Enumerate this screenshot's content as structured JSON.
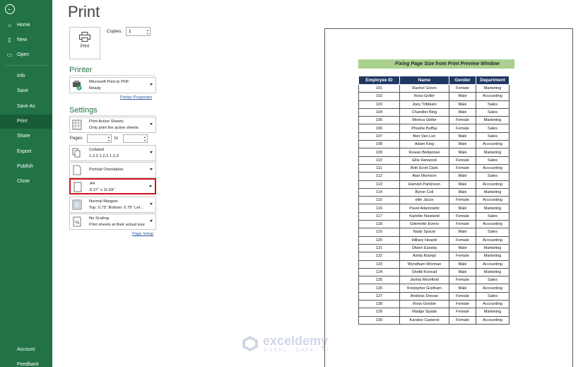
{
  "sidebar": {
    "back_icon": "arrow-left-icon",
    "items_top": [
      {
        "label": "Home",
        "icon": "home-icon"
      },
      {
        "label": "New",
        "icon": "new-file-icon"
      },
      {
        "label": "Open",
        "icon": "folder-open-icon"
      }
    ],
    "items_mid": [
      "Info",
      "Save",
      "Save As",
      "Print",
      "Share",
      "Export",
      "Publish",
      "Close"
    ],
    "active": "Print",
    "items_bottom": [
      "Account",
      "Feedback"
    ]
  },
  "print_panel": {
    "title": "Print",
    "print_button_label": "Print",
    "copies_label": "Copies:",
    "copies_value": "1",
    "printer_header": "Printer",
    "printer_name": "Microsoft Print to PDF",
    "printer_status": "Ready",
    "printer_properties_link": "Printer Properties",
    "settings_header": "Settings",
    "options": [
      {
        "line1": "Print Active Sheets",
        "line2": "Only print the active sheets",
        "icon": "sheets-icon"
      },
      {
        "line1": "Collated",
        "line2": "1,2,3    1,2,3    1,2,3",
        "icon": "collate-icon"
      },
      {
        "line1": "Portrait Orientation",
        "line2": "",
        "icon": "portrait-page-icon"
      },
      {
        "line1": "A4",
        "line2": "8.27\" x 11.69\"",
        "icon": "paper-size-icon"
      },
      {
        "line1": "Normal Margins",
        "line2": "Top: 0.75\" Bottom: 0.75\" Lef...",
        "icon": "margins-icon"
      },
      {
        "line1": "No Scaling",
        "line2": "Print sheets at their actual size",
        "icon": "scaling-icon"
      }
    ],
    "pages_label": "Pages:",
    "to_label": "to",
    "page_setup_link": "Page Setup"
  },
  "preview": {
    "sheet_title": "Fixing Page Size from Print Preview Window",
    "columns": [
      "Employee ID",
      "Name",
      "Gender",
      "Department"
    ],
    "rows": [
      [
        "101",
        "Rachel Green",
        "Female",
        "Marketing"
      ],
      [
        "102",
        "Ross Geller",
        "Male",
        "Accounting"
      ],
      [
        "103",
        "Joey Tribbiani",
        "Male",
        "Sales"
      ],
      [
        "104",
        "Chandler Bing",
        "Male",
        "Sales"
      ],
      [
        "105",
        "Monica Geller",
        "Female",
        "Marketing"
      ],
      [
        "106",
        "Phoebe Buffay",
        "Female",
        "Sales"
      ],
      [
        "107",
        "Ben Van Lier",
        "Male",
        "Sales"
      ],
      [
        "108",
        "Adam King",
        "Male",
        "Accounting"
      ],
      [
        "109",
        "Rowan Bettjeman",
        "Male",
        "Marketing"
      ],
      [
        "110",
        "Ellie Harwood",
        "Female",
        "Sales"
      ],
      [
        "111",
        "Britt Scott Clark",
        "Female",
        "Accounting"
      ],
      [
        "112",
        "Alan Morrison",
        "Male",
        "Sales"
      ],
      [
        "113",
        "Hamish Parkinson",
        "Male",
        "Accounting"
      ],
      [
        "114",
        "Byron Coll",
        "Male",
        "Marketing"
      ],
      [
        "115",
        "ellie Jacox",
        "Female",
        "Accounting"
      ],
      [
        "116",
        "Pavel Adamowitz",
        "Male",
        "Marketing"
      ],
      [
        "117",
        "Karlotte Nowland",
        "Female",
        "Sales"
      ],
      [
        "118",
        "Gilemette Everix",
        "Female",
        "Accounting"
      ],
      [
        "119",
        "Nady Spacie",
        "Male",
        "Sales"
      ],
      [
        "120",
        "Hilliary Heazel",
        "Female",
        "Accounting"
      ],
      [
        "121",
        "Olwen Esseby",
        "Male",
        "Marketing"
      ],
      [
        "122",
        "Ashla Klampt",
        "Female",
        "Marketing"
      ],
      [
        "123",
        "Wyndham Worman",
        "Male",
        "Accounting"
      ],
      [
        "124",
        "Shelbi Konrad",
        "Male",
        "Marketing"
      ],
      [
        "125",
        "Joshia Moorfield",
        "Female",
        "Sales"
      ],
      [
        "126",
        "Kristopher Gretham",
        "Male",
        "Accounting"
      ],
      [
        "127",
        "Andonis Dresse",
        "Female",
        "Sales"
      ],
      [
        "128",
        "Rose Gooble",
        "Female",
        "Accounting"
      ],
      [
        "129",
        "Madge Spada",
        "Female",
        "Marketing"
      ],
      [
        "130",
        "Karalee Casterot",
        "Female",
        "Accounting"
      ]
    ]
  },
  "watermark": {
    "name": "exceldemy",
    "tagline": "EXCEL · DATA · BI"
  },
  "colors": {
    "sidebar": "#217346",
    "sidebar_active": "#185c37",
    "header_fill": "#203864",
    "title_fill": "#a9d08e",
    "highlight": "#d0121b"
  }
}
